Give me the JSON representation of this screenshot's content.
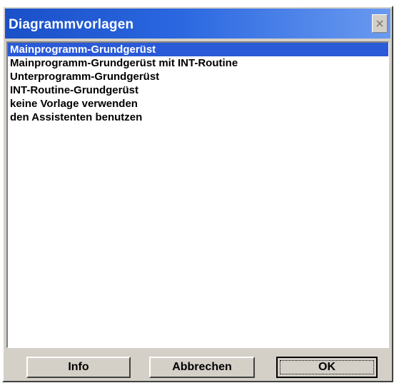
{
  "dialog": {
    "title": "Diagrammvorlagen"
  },
  "templates": {
    "items": [
      {
        "label": "Mainprogramm-Grundgerüst",
        "selected": true
      },
      {
        "label": "Mainprogramm-Grundgerüst mit INT-Routine",
        "selected": false
      },
      {
        "label": "Unterprogramm-Grundgerüst",
        "selected": false
      },
      {
        "label": "INT-Routine-Grundgerüst",
        "selected": false
      },
      {
        "label": "keine Vorlage verwenden",
        "selected": false
      },
      {
        "label": "den Assistenten benutzen",
        "selected": false
      }
    ]
  },
  "buttons": {
    "info": "Info",
    "cancel": "Abbrechen",
    "ok": "OK"
  },
  "colors": {
    "title_bar": "#1a50c8",
    "selection": "#2a5ad8",
    "dialog_face": "#d4d0c8"
  },
  "icons": {
    "close": "close-icon"
  }
}
